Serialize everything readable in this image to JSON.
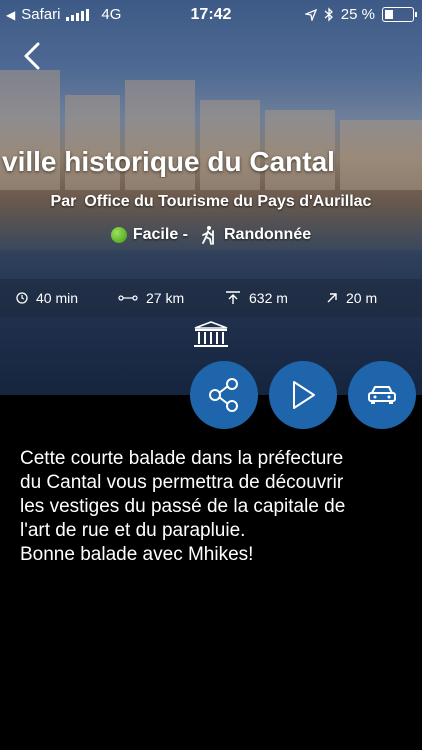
{
  "status_bar": {
    "carrier": "Safari",
    "network": "4G",
    "time": "17:42",
    "battery": "25 %"
  },
  "hike": {
    "title": "ville historique du Cantal",
    "author_prefix": "Par",
    "author": "Office du Tourisme du Pays d'Aurillac",
    "difficulty": "Facile -",
    "activity": "Randonnée"
  },
  "stats": {
    "duration": "40 min",
    "distance": "27 km",
    "elevation_gain": "632 m",
    "ascent": "20 m"
  },
  "description": [
    "Cette courte balade dans la préfecture",
    "du Cantal vous permettra de découvrir",
    "les vestiges du passé de la capitale de",
    "l'art de rue et du parapluie.",
    "Bonne balade avec Mhikes!"
  ],
  "colors": {
    "accent": "#1e65ab",
    "difficulty_dot": "#5cc12b"
  },
  "icons": {
    "back": "chevron-left-icon",
    "share": "share-icon",
    "play": "play-icon",
    "car": "car-icon",
    "monument": "monument-icon"
  }
}
